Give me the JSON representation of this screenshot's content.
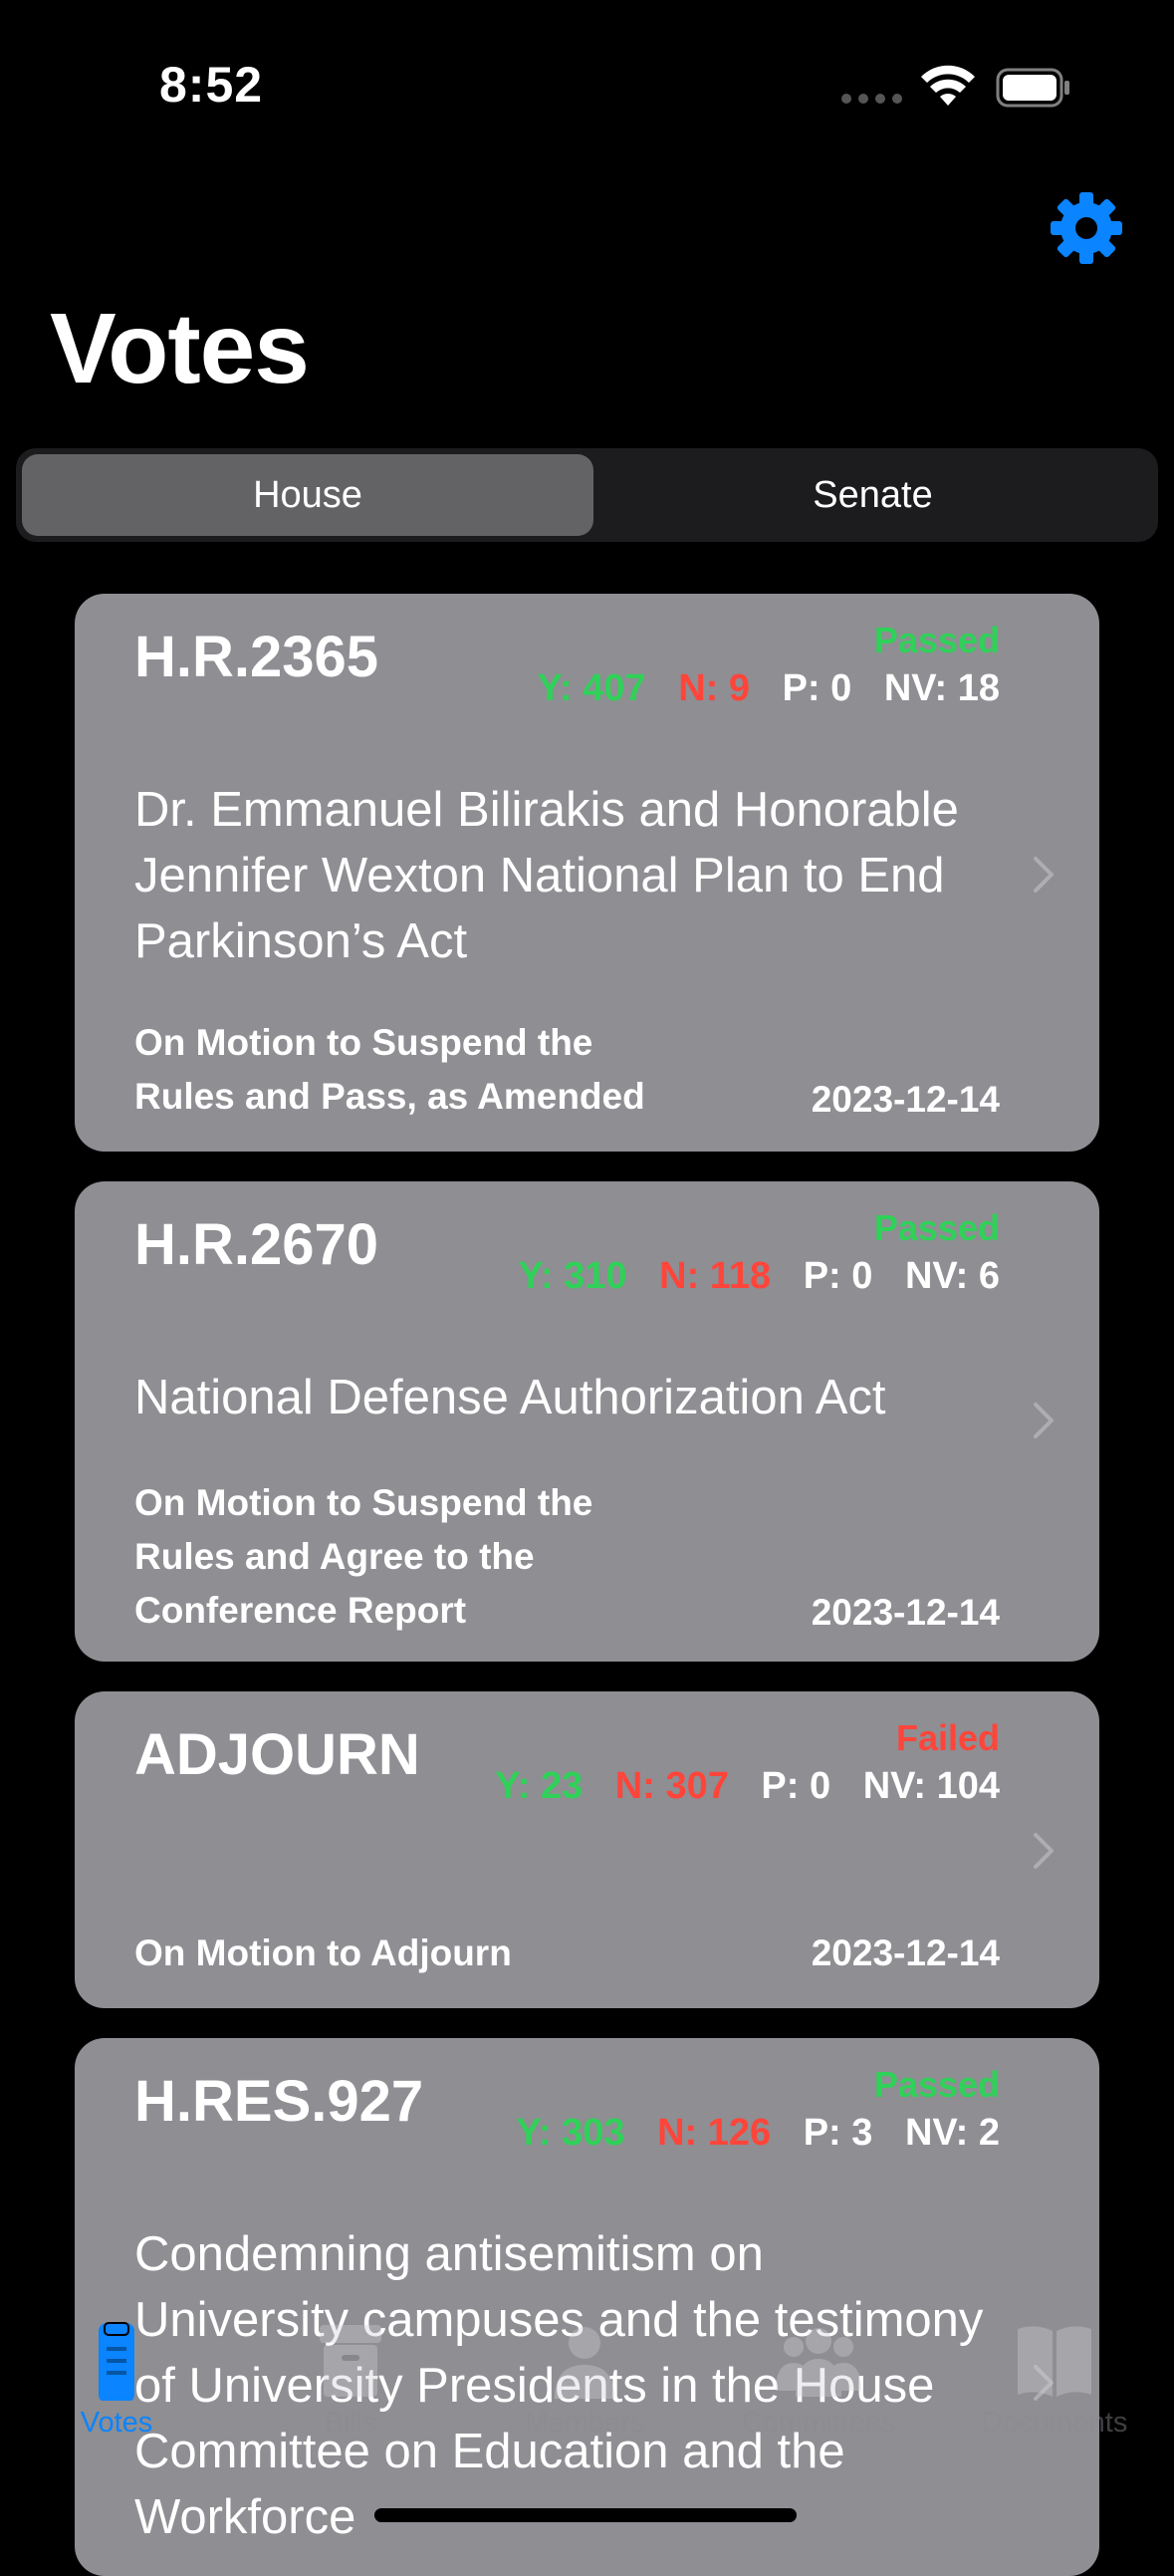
{
  "status_bar": {
    "time": "8:52"
  },
  "header": {
    "title": "Votes",
    "settings_icon": "gear-icon"
  },
  "chamber_toggle": {
    "options": [
      "House",
      "Senate"
    ],
    "selected": "House"
  },
  "colors": {
    "accent": "#0a84ff",
    "yes": "#30d158",
    "no": "#ff453a",
    "card": "#8e8e93"
  },
  "votes": [
    {
      "bill": "H.R.2365",
      "result": "Passed",
      "yes": "Y: 407",
      "no": "N: 9",
      "present": "P: 0",
      "not_voting": "NV: 18",
      "description": "Dr. Emmanuel Bilirakis and Honorable Jennifer Wexton National Plan to End Parkinson’s Act",
      "question": "On Motion to Suspend the Rules and Pass, as Amended",
      "date": "2023-12-14"
    },
    {
      "bill": "H.R.2670",
      "result": "Passed",
      "yes": "Y: 310",
      "no": "N: 118",
      "present": "P: 0",
      "not_voting": "NV: 6",
      "description": "National Defense Authorization Act",
      "question": "On Motion to Suspend the Rules and Agree to the Conference Report",
      "date": "2023-12-14"
    },
    {
      "bill": "ADJOURN",
      "result": "Failed",
      "yes": "Y: 23",
      "no": "N: 307",
      "present": "P: 0",
      "not_voting": "NV: 104",
      "description": "",
      "question": "On Motion to Adjourn",
      "date": "2023-12-14"
    },
    {
      "bill": "H.RES.927",
      "result": "Passed",
      "yes": "Y: 303",
      "no": "N: 126",
      "present": "P: 3",
      "not_voting": "NV: 2",
      "description": "Condemning antisemitism on University campuses and the testimony of University Presidents in the House Committee on Education and the Workforce",
      "question": "",
      "date": ""
    }
  ],
  "tab_bar": {
    "items": [
      {
        "label": "Votes",
        "icon": "clipboard-icon",
        "active": true
      },
      {
        "label": "Bills",
        "icon": "archive-box-icon",
        "active": false
      },
      {
        "label": "Members",
        "icon": "person-icon",
        "active": false
      },
      {
        "label": "Committees",
        "icon": "people-group-icon",
        "active": false
      },
      {
        "label": "Documents",
        "icon": "book-icon",
        "active": false
      }
    ]
  }
}
